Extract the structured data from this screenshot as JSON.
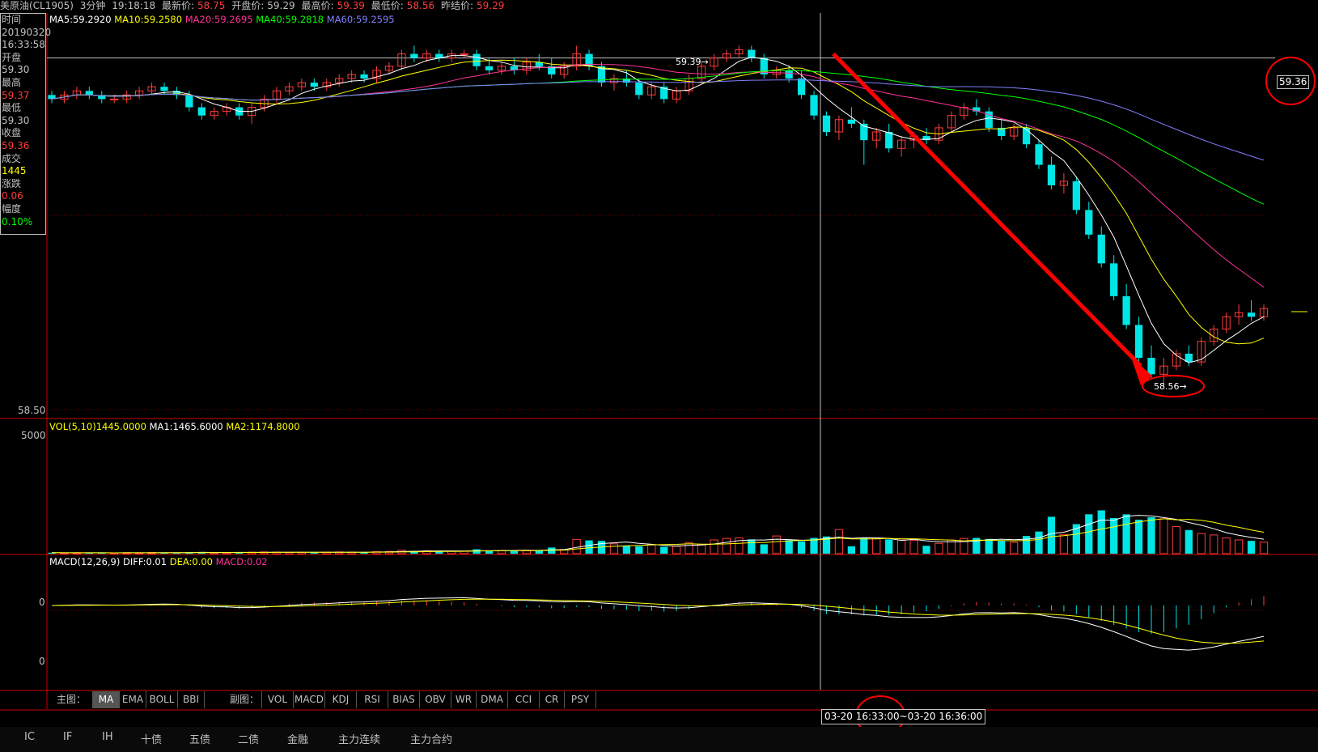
{
  "header": {
    "symbol": "美原油(CL1905)",
    "period": "3分钟",
    "time": "19:18:18",
    "latest_label": "最新价:",
    "latest_value": "58.75",
    "open_label": "开盘价:",
    "open_value": "59.29",
    "high_label": "最高价:",
    "high_value": "59.39",
    "low_label": "最低价:",
    "low_value": "58.56",
    "prev_label": "昨结价:",
    "prev_value": "59.29"
  },
  "infobox": {
    "time_label": "时间",
    "date": "20190320",
    "time": "16:33:58",
    "open_label": "开盘",
    "open": "59.30",
    "high_label": "最高",
    "high": "59.37",
    "low_label": "最低",
    "low": "59.30",
    "close_label": "收盘",
    "close": "59.36",
    "vol_label": "成交",
    "vol": "1445",
    "chg_label": "涨跌",
    "chg": "0.06",
    "amp_label": "幅度",
    "amp": "0.10%"
  },
  "ma_legend": {
    "ma5": "MA5:59.2920",
    "ma10": "MA10:59.2580",
    "ma20": "MA20:59.2695",
    "ma40": "MA40:59.2818",
    "ma60": "MA60:59.2595"
  },
  "price_axis": {
    "low_tick": "58.50",
    "crosshair_price": "59.36",
    "max_marker": "59.39",
    "min_marker": "58.56"
  },
  "volume_panel": {
    "legend": "VOL(5,10)1445.0000",
    "ma1": "MA1:1465.6000",
    "ma2": "MA2:1174.8000",
    "top_tick": "5000"
  },
  "macd_panel": {
    "legend": "MACD(12,26,9)",
    "diff": "DIFF:0.01",
    "dea": "DEA:0.00",
    "macd": "MACD:0.02",
    "tick1": "0",
    "tick2": "0"
  },
  "main_tabs": {
    "label": "主图：",
    "items": [
      "MA",
      "EMA",
      "BOLL",
      "BBI"
    ]
  },
  "sub_tabs": {
    "label": "副图：",
    "items": [
      "VOL",
      "MACD",
      "KDJ",
      "RSI",
      "BIAS",
      "OBV",
      "WR",
      "DMA",
      "CCI",
      "CR",
      "PSY"
    ]
  },
  "time_range": {
    "start": "03-20",
    "start_time": "16:33:00",
    "sep": "~",
    "end": "03-20 16:36:00"
  },
  "bottom_tabs": [
    "IC",
    "IF",
    "IH",
    "十债",
    "五债",
    "二债",
    "金融",
    "主力连续",
    "主力合约"
  ],
  "colors": {
    "up": "#ff3b3b",
    "down": "#00e5e5",
    "ma5": "#ffffff",
    "ma10": "#ffff00",
    "ma20": "#ff3399",
    "ma40": "#00ff00",
    "ma60": "#8080ff",
    "frame": "#cc0000",
    "annotation": "#ff0000"
  },
  "chart_data": {
    "type": "candlestick",
    "instrument": "CL1905",
    "interval": "3min",
    "ylim": [
      58.5,
      59.45
    ],
    "ohlc": [
      [
        59.27,
        59.28,
        59.25,
        59.26
      ],
      [
        59.26,
        59.28,
        59.25,
        59.27
      ],
      [
        59.27,
        59.29,
        59.26,
        59.28
      ],
      [
        59.28,
        59.29,
        59.26,
        59.27
      ],
      [
        59.27,
        59.28,
        59.25,
        59.26
      ],
      [
        59.26,
        59.27,
        59.25,
        59.26
      ],
      [
        59.26,
        59.28,
        59.25,
        59.27
      ],
      [
        59.27,
        59.29,
        59.26,
        59.28
      ],
      [
        59.28,
        59.3,
        59.27,
        59.29
      ],
      [
        59.29,
        59.3,
        59.27,
        59.28
      ],
      [
        59.28,
        59.29,
        59.26,
        59.27
      ],
      [
        59.27,
        59.28,
        59.23,
        59.24
      ],
      [
        59.24,
        59.25,
        59.21,
        59.22
      ],
      [
        59.22,
        59.24,
        59.21,
        59.23
      ],
      [
        59.23,
        59.25,
        59.22,
        59.24
      ],
      [
        59.24,
        59.25,
        59.21,
        59.22
      ],
      [
        59.22,
        59.25,
        59.2,
        59.24
      ],
      [
        59.24,
        59.27,
        59.23,
        59.26
      ],
      [
        59.26,
        59.29,
        59.25,
        59.28
      ],
      [
        59.28,
        59.3,
        59.27,
        59.29
      ],
      [
        59.29,
        59.31,
        59.28,
        59.3
      ],
      [
        59.3,
        59.31,
        59.28,
        59.29
      ],
      [
        59.29,
        59.31,
        59.28,
        59.3
      ],
      [
        59.3,
        59.32,
        59.29,
        59.31
      ],
      [
        59.31,
        59.33,
        59.3,
        59.32
      ],
      [
        59.32,
        59.33,
        59.3,
        59.31
      ],
      [
        59.31,
        59.34,
        59.3,
        59.33
      ],
      [
        59.33,
        59.35,
        59.32,
        59.34
      ],
      [
        59.34,
        59.38,
        59.33,
        59.37
      ],
      [
        59.37,
        59.39,
        59.35,
        59.36
      ],
      [
        59.36,
        59.38,
        59.35,
        59.37
      ],
      [
        59.37,
        59.38,
        59.35,
        59.36
      ],
      [
        59.36,
        59.38,
        59.35,
        59.37
      ],
      [
        59.37,
        59.38,
        59.36,
        59.37
      ],
      [
        59.37,
        59.38,
        59.33,
        59.34
      ],
      [
        59.34,
        59.36,
        59.32,
        59.33
      ],
      [
        59.33,
        59.35,
        59.32,
        59.34
      ],
      [
        59.34,
        59.36,
        59.32,
        59.33
      ],
      [
        59.33,
        59.36,
        59.32,
        59.35
      ],
      [
        59.35,
        59.37,
        59.33,
        59.34
      ],
      [
        59.34,
        59.36,
        59.31,
        59.32
      ],
      [
        59.32,
        59.35,
        59.31,
        59.34
      ],
      [
        59.34,
        59.39,
        59.33,
        59.37
      ],
      [
        59.37,
        59.38,
        59.33,
        59.34
      ],
      [
        59.34,
        59.35,
        59.29,
        59.3
      ],
      [
        59.3,
        59.32,
        59.28,
        59.31
      ],
      [
        59.31,
        59.33,
        59.29,
        59.3
      ],
      [
        59.3,
        59.31,
        59.26,
        59.27
      ],
      [
        59.27,
        59.3,
        59.26,
        59.29
      ],
      [
        59.29,
        59.3,
        59.25,
        59.26
      ],
      [
        59.26,
        59.29,
        59.25,
        59.28
      ],
      [
        59.28,
        59.32,
        59.27,
        59.31
      ],
      [
        59.31,
        59.35,
        59.3,
        59.34
      ],
      [
        59.34,
        59.37,
        59.33,
        59.36
      ],
      [
        59.36,
        59.38,
        59.35,
        59.37
      ],
      [
        59.37,
        59.39,
        59.36,
        59.38
      ],
      [
        59.38,
        59.39,
        59.35,
        59.36
      ],
      [
        59.36,
        59.37,
        59.31,
        59.32
      ],
      [
        59.32,
        59.34,
        59.31,
        59.33
      ],
      [
        59.33,
        59.34,
        59.3,
        59.31
      ],
      [
        59.31,
        59.33,
        59.26,
        59.27
      ],
      [
        59.27,
        59.28,
        59.21,
        59.22
      ],
      [
        59.22,
        59.23,
        59.17,
        59.18
      ],
      [
        59.18,
        59.22,
        59.16,
        59.21
      ],
      [
        59.21,
        59.24,
        59.19,
        59.2
      ],
      [
        59.2,
        59.21,
        59.1,
        59.16
      ],
      [
        59.16,
        59.19,
        59.14,
        59.18
      ],
      [
        59.18,
        59.2,
        59.13,
        59.14
      ],
      [
        59.14,
        59.17,
        59.12,
        59.16
      ],
      [
        59.16,
        59.18,
        59.14,
        59.17
      ],
      [
        59.17,
        59.19,
        59.15,
        59.16
      ],
      [
        59.16,
        59.2,
        59.15,
        59.19
      ],
      [
        59.19,
        59.23,
        59.18,
        59.22
      ],
      [
        59.22,
        59.25,
        59.21,
        59.24
      ],
      [
        59.24,
        59.26,
        59.22,
        59.23
      ],
      [
        59.23,
        59.24,
        59.18,
        59.19
      ],
      [
        59.19,
        59.21,
        59.16,
        59.17
      ],
      [
        59.17,
        59.2,
        59.16,
        59.19
      ],
      [
        59.19,
        59.2,
        59.14,
        59.15
      ],
      [
        59.15,
        59.16,
        59.09,
        59.1
      ],
      [
        59.1,
        59.12,
        59.04,
        59.05
      ],
      [
        59.05,
        59.08,
        59.03,
        59.06
      ],
      [
        59.06,
        59.07,
        58.98,
        58.99
      ],
      [
        58.99,
        59.01,
        58.92,
        58.93
      ],
      [
        58.93,
        58.95,
        58.85,
        58.86
      ],
      [
        58.86,
        58.88,
        58.77,
        58.78
      ],
      [
        58.78,
        58.81,
        58.7,
        58.71
      ],
      [
        58.71,
        58.73,
        58.62,
        58.63
      ],
      [
        58.63,
        58.66,
        58.58,
        58.59
      ],
      [
        58.59,
        58.63,
        58.56,
        58.61
      ],
      [
        58.61,
        58.65,
        58.6,
        58.64
      ],
      [
        58.64,
        58.66,
        58.61,
        58.62
      ],
      [
        58.62,
        58.68,
        58.61,
        58.67
      ],
      [
        58.67,
        58.71,
        58.66,
        58.7
      ],
      [
        58.7,
        58.74,
        58.69,
        58.73
      ],
      [
        58.73,
        58.76,
        58.71,
        58.74
      ],
      [
        58.74,
        58.77,
        58.72,
        58.73
      ],
      [
        58.73,
        58.76,
        58.72,
        58.75
      ]
    ],
    "volume": [
      40,
      30,
      35,
      45,
      30,
      25,
      40,
      35,
      50,
      45,
      30,
      60,
      70,
      40,
      45,
      55,
      60,
      70,
      65,
      50,
      55,
      45,
      60,
      70,
      65,
      50,
      80,
      90,
      140,
      110,
      120,
      95,
      100,
      105,
      180,
      120,
      130,
      115,
      140,
      150,
      250,
      170,
      580,
      540,
      520,
      400,
      330,
      300,
      360,
      280,
      300,
      450,
      380,
      560,
      620,
      640,
      580,
      380,
      720,
      550,
      500,
      640,
      700,
      980,
      300,
      640,
      610,
      580,
      560,
      540,
      320,
      420,
      560,
      620,
      640,
      600,
      520,
      460,
      720,
      900,
      1500,
      780,
      1200,
      1600,
      1760,
      1450,
      1600,
      1380,
      1480,
      1420,
      1100,
      960,
      820,
      760,
      640,
      560,
      520,
      470
    ],
    "series": [
      {
        "name": "MA5",
        "values": [
          59.292
        ]
      },
      {
        "name": "MA10",
        "values": [
          59.258
        ]
      },
      {
        "name": "MA20",
        "values": [
          59.2695
        ]
      },
      {
        "name": "MA40",
        "values": [
          59.2818
        ]
      },
      {
        "name": "MA60",
        "values": [
          59.2595
        ]
      }
    ],
    "macd": {
      "diff": 0.01,
      "dea": 0.0,
      "macd": 0.02
    },
    "annotations": [
      "59.39",
      "58.56",
      "59.36"
    ]
  }
}
